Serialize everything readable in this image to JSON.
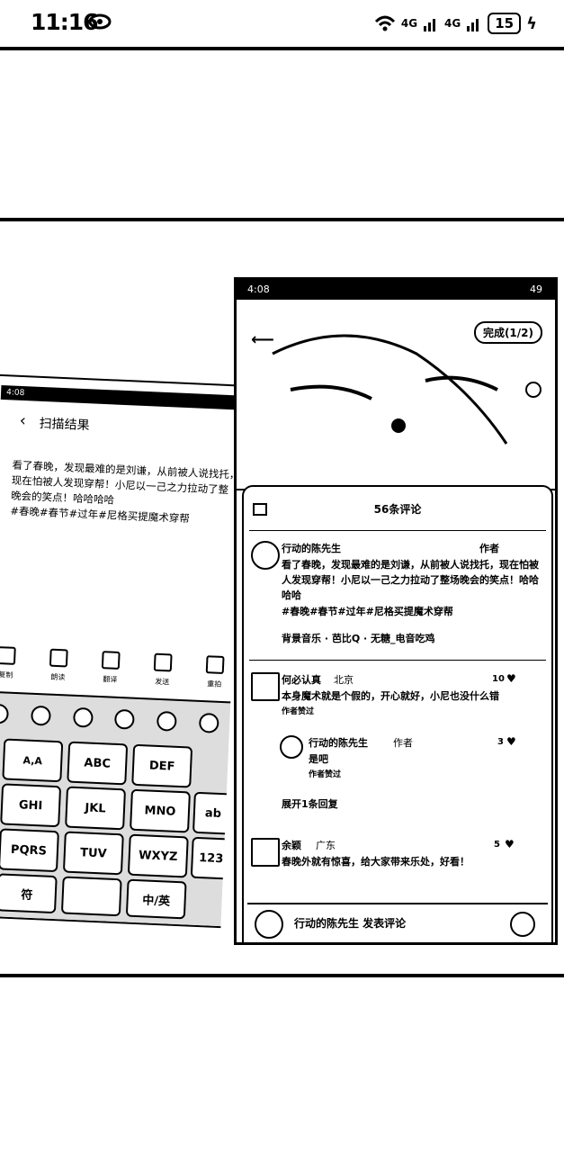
{
  "status_bar": {
    "time": "11:16",
    "signal1": "4G",
    "signal2": "4G",
    "battery": "15"
  },
  "left_screenshot": {
    "time": "4:08",
    "title": "扫描结果",
    "text_lines": [
      "看了春晚，发现最难的是刘谦，从前被人说找托，",
      "现在怕被人发现穿帮！小尼以一己之力拉动了整",
      "晚会的笑点！哈哈哈哈",
      "#春晚#春节#过年#尼格买提魔术穿帮"
    ],
    "tools": [
      "复制",
      "朗读",
      "翻译",
      "发送",
      "重拍"
    ],
    "keys": [
      "ABC",
      "DEF",
      "GHI",
      "JKL",
      "MNO",
      "PQRS",
      "TUV",
      "WXYZ",
      "符",
      "中/英",
      "123",
      "ab"
    ]
  },
  "right_screenshot": {
    "time": "4:08",
    "battery": "49",
    "done_label": "完成(1/2)",
    "comment_count": "56条评论",
    "comments": [
      {
        "author": "行动的陈先生",
        "meta": "作者",
        "text": "看了春晚，发现最难的是刘谦，从前被人说找托，现在怕被人发现穿帮！小尼以一己之力拉动了整场晚会的笑点！哈哈哈哈",
        "tags": "#春晚#春节#过年#尼格买提魔术穿帮",
        "music": "背景音乐 · 芭比Q · 无糖_电音吃鸡"
      },
      {
        "author": "何必认真",
        "meta": "北京",
        "text": "本身魔术就是个假的，开心就好，小尼也没什么错",
        "reply_label": "作者赞过",
        "likes": "10"
      },
      {
        "author": "行动的陈先生",
        "meta": "作者",
        "text": "是吧",
        "reply_label": "作者赞过",
        "likes": "3"
      },
      {
        "expand": "展开1条回复"
      },
      {
        "author": "余颖",
        "meta": "广东",
        "text": "春晚外就有惊喜，给大家带来乐处，好看！",
        "likes": "5"
      }
    ],
    "input_placeholder": "行动的陈先生 发表评论"
  }
}
